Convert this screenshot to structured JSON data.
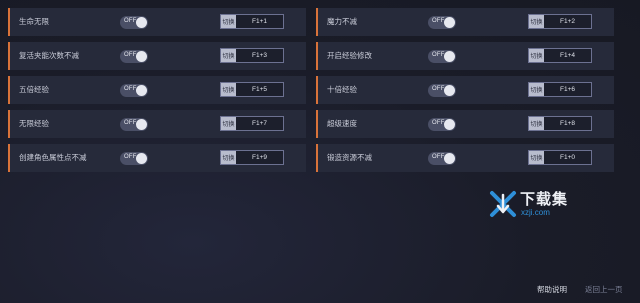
{
  "cheats": [
    {
      "name": "生命无限",
      "toggle": "OFF",
      "switch_label": "切换",
      "hotkey": "F1+1"
    },
    {
      "name": "魔力不减",
      "toggle": "OFF",
      "switch_label": "切换",
      "hotkey": "F1+2"
    },
    {
      "name": "复活夹能次数不减",
      "toggle": "OFF",
      "switch_label": "切换",
      "hotkey": "F1+3"
    },
    {
      "name": "开启经验修改",
      "toggle": "OFF",
      "switch_label": "切换",
      "hotkey": "F1+4"
    },
    {
      "name": "五倍经验",
      "toggle": "OFF",
      "switch_label": "切换",
      "hotkey": "F1+5"
    },
    {
      "name": "十倍经验",
      "toggle": "OFF",
      "switch_label": "切换",
      "hotkey": "F1+6"
    },
    {
      "name": "无限经验",
      "toggle": "OFF",
      "switch_label": "切换",
      "hotkey": "F1+7"
    },
    {
      "name": "超级速度",
      "toggle": "OFF",
      "switch_label": "切换",
      "hotkey": "F1+8"
    },
    {
      "name": "创建角色属性点不减",
      "toggle": "OFF",
      "switch_label": "切换",
      "hotkey": "F1+9"
    },
    {
      "name": "锻造资源不减",
      "toggle": "OFF",
      "switch_label": "切换",
      "hotkey": "F1+0"
    }
  ],
  "watermark": {
    "title": "下载集",
    "domain": "xzji.com",
    "accent": "#2e8fd8"
  },
  "footer": {
    "help": "帮助说明",
    "back": "返回上一页"
  },
  "colors": {
    "accent_border": "#d9733a",
    "card_bg": "#262a3a",
    "toggle_off": "#4a4f66"
  }
}
